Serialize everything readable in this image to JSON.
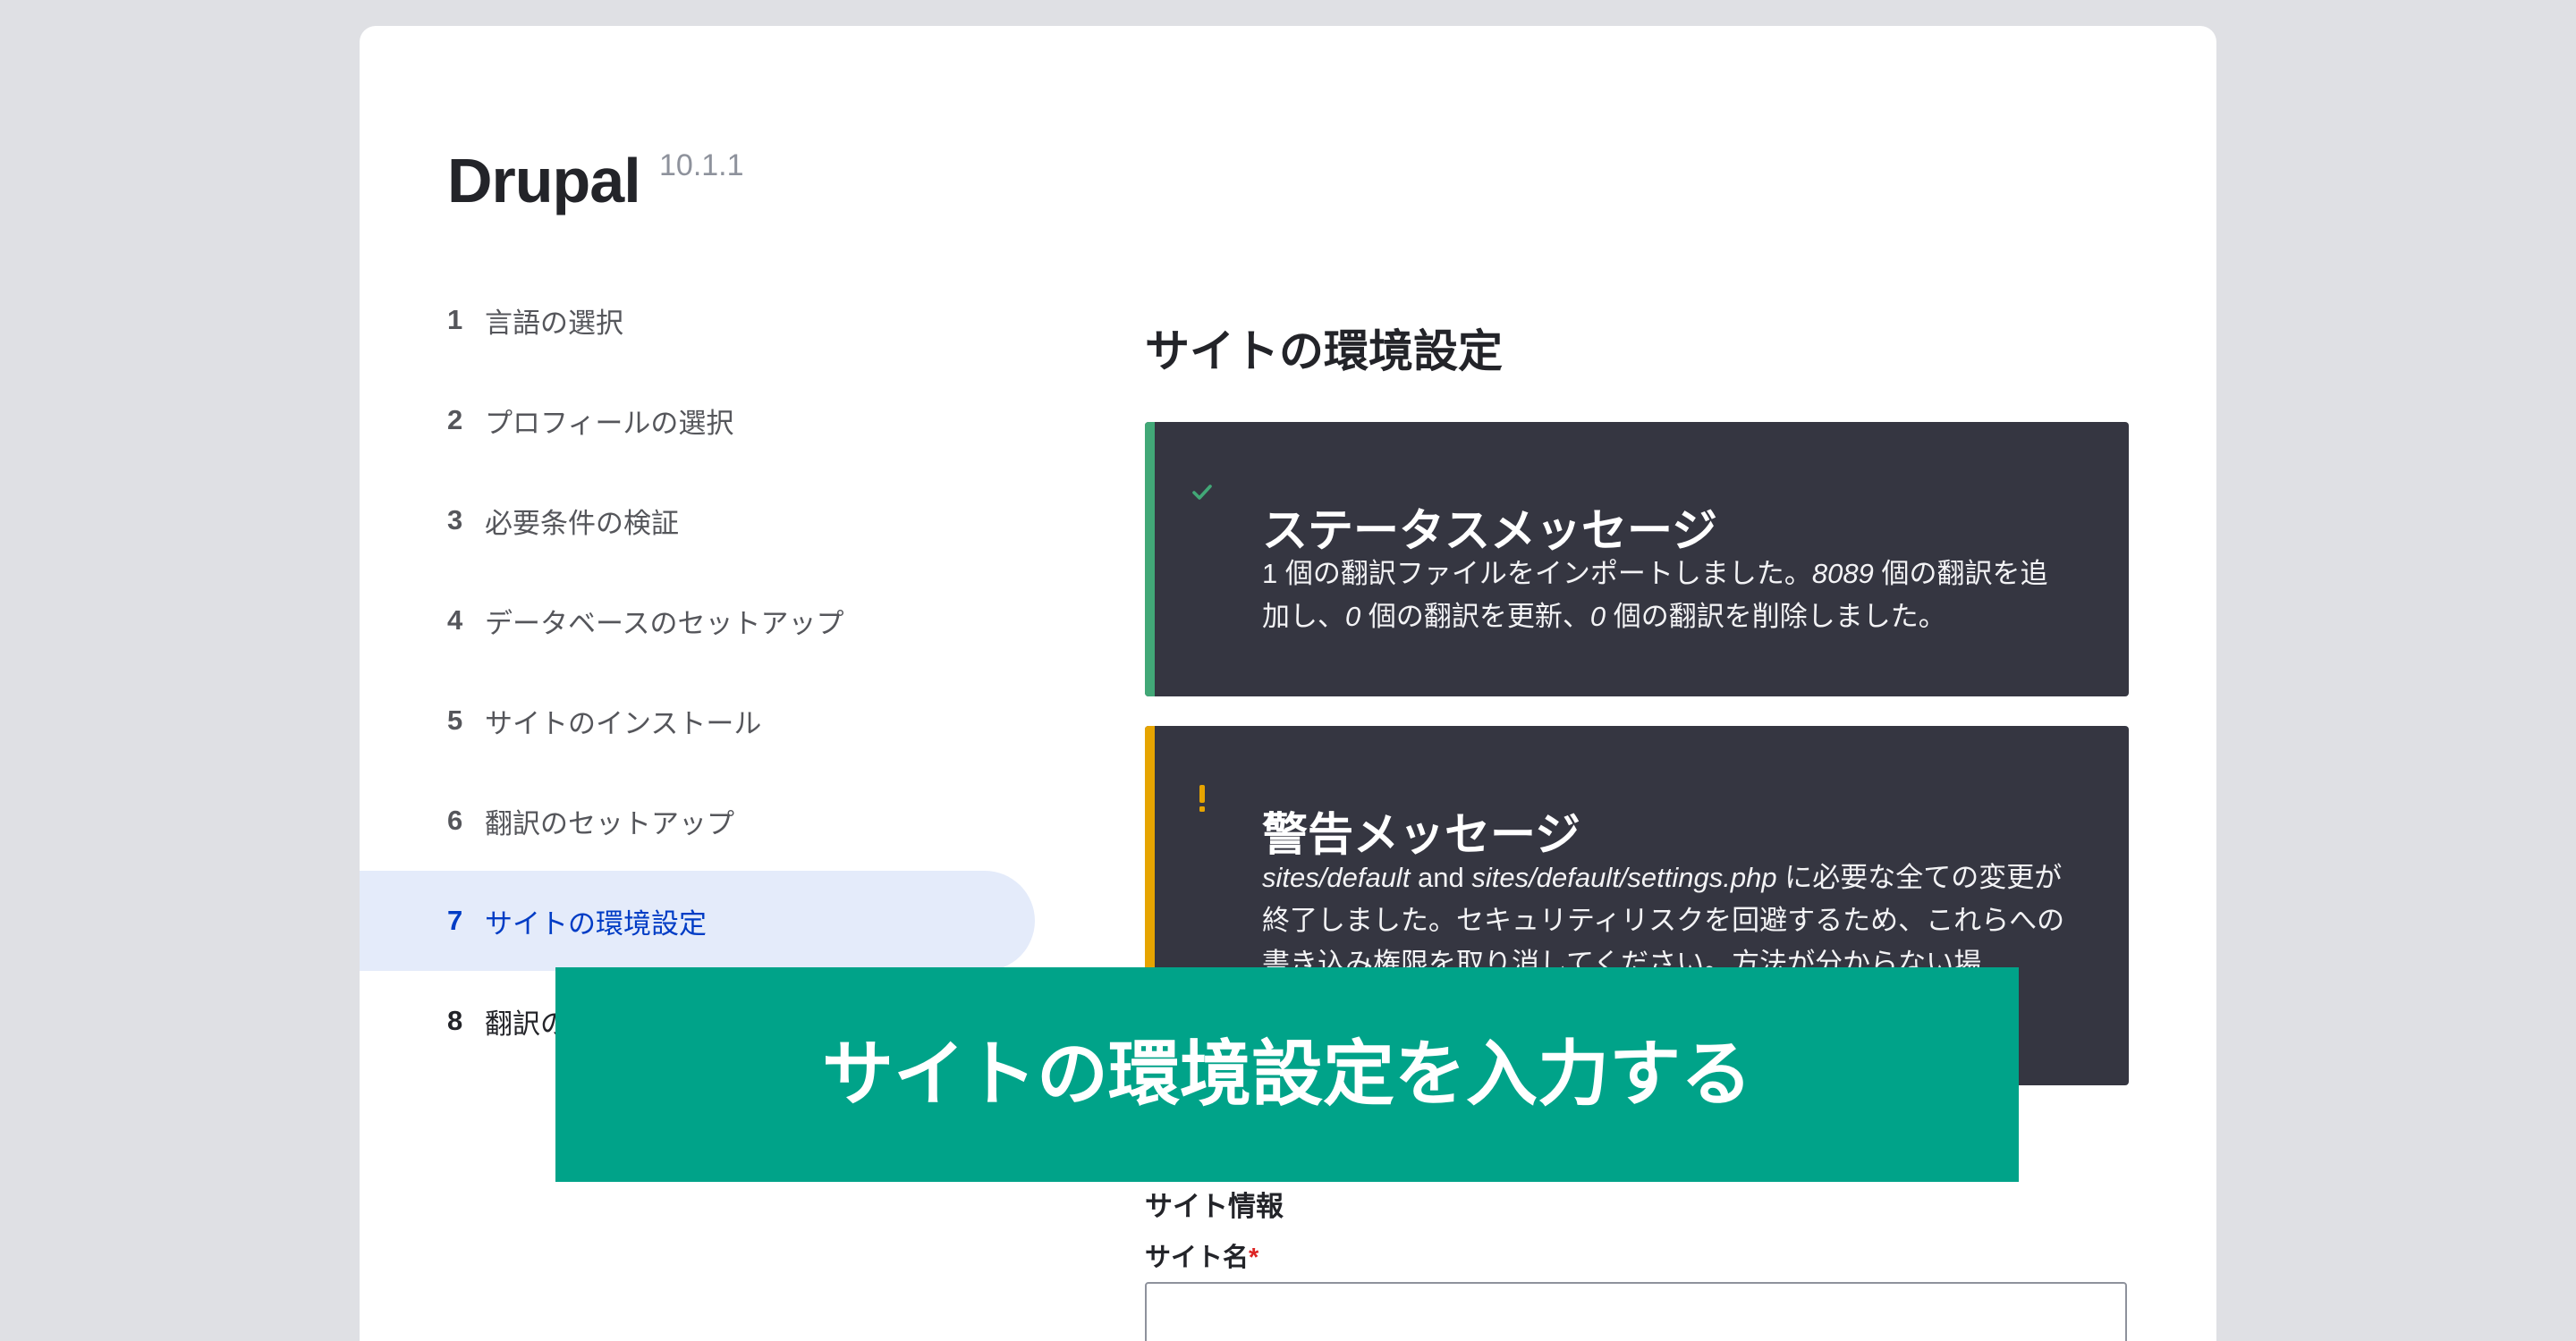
{
  "app": {
    "title": "Drupal",
    "version": "10.1.1"
  },
  "steps": [
    {
      "number": "1",
      "label": "言語の選択",
      "state": "done"
    },
    {
      "number": "2",
      "label": "プロフィールの選択",
      "state": "done"
    },
    {
      "number": "3",
      "label": "必要条件の検証",
      "state": "done"
    },
    {
      "number": "4",
      "label": "データベースのセットアップ",
      "state": "done"
    },
    {
      "number": "5",
      "label": "サイトのインストール",
      "state": "done"
    },
    {
      "number": "6",
      "label": "翻訳のセットアップ",
      "state": "done"
    },
    {
      "number": "7",
      "label": "サイトの環境設定",
      "state": "active"
    },
    {
      "number": "8",
      "label": "翻訳の",
      "state": "upcoming"
    }
  ],
  "main": {
    "heading": "サイトの環境設定"
  },
  "status_message": {
    "icon": "check-icon",
    "title": "ステータスメッセージ",
    "body": [
      "1 個の翻訳ファイルをインポートしました。",
      "8089",
      " 個の翻訳を追加し、",
      "0",
      " 個の翻訳を更新、",
      "0",
      " 個の翻訳を削除しました。"
    ]
  },
  "warning_message": {
    "icon": "exclamation-icon",
    "title": "警告メッセージ",
    "body": [
      "sites/default",
      " and ",
      "sites/default/settings.php",
      " に必要な全ての変更が終了しました。セキュリティリスクを回避するため、これらへの書き込み権限を取り消してください。方法が分からない場"
    ]
  },
  "form": {
    "section_title": "サイト情報",
    "site_name_label": "サイト名",
    "required_mark": "*",
    "site_name_value": ""
  },
  "overlay": {
    "text": "サイトの環境設定を入力する"
  },
  "colors": {
    "page_background": "#dfe0e4",
    "active_step_background": "#e4ebfa",
    "active_step_text": "#003cc5",
    "message_background": "#353641",
    "status_accent": "#42a877",
    "warning_accent": "#e6a400",
    "required_mark": "#dc2323",
    "overlay_background": "#00a389"
  }
}
